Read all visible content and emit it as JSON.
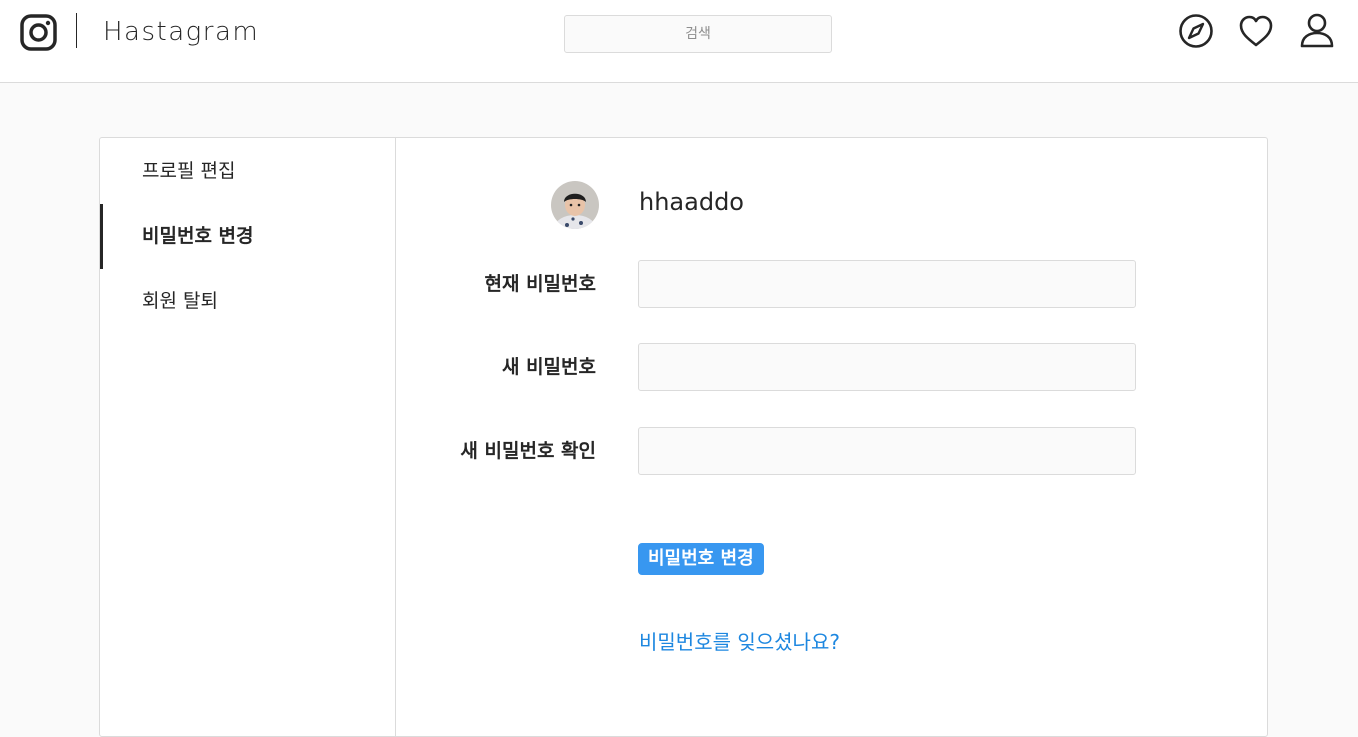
{
  "header": {
    "brand": "Hastagram",
    "search_placeholder": "검색"
  },
  "sidebar": {
    "items": [
      {
        "label": "프로필 편집",
        "active": false
      },
      {
        "label": "비밀번호 변경",
        "active": true
      },
      {
        "label": "회원 탈퇴",
        "active": false
      }
    ]
  },
  "main": {
    "username": "hhaaddo",
    "fields": [
      {
        "label": "현재 비밀번호",
        "value": ""
      },
      {
        "label": "새 비밀번호",
        "value": ""
      },
      {
        "label": "새 비밀번호 확인",
        "value": ""
      }
    ],
    "submit_label": "비밀번호 변경",
    "forgot_link": "비밀번호를 잊으셨나요?"
  },
  "colors": {
    "accent": "#3897f0",
    "link": "#1d87e0",
    "border": "#dbdbdb",
    "background": "#fafafa"
  },
  "icons": [
    "instagram-logo-icon",
    "explore-icon",
    "heart-icon",
    "profile-icon"
  ]
}
